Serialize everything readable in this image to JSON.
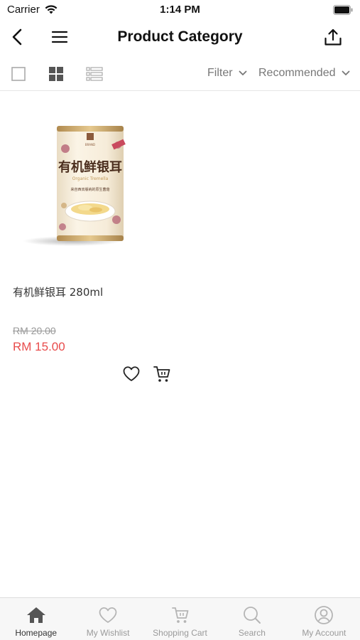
{
  "status_bar": {
    "carrier": "Carrier",
    "time": "1:14 PM"
  },
  "header": {
    "title": "Product Category"
  },
  "toolbar": {
    "filter_label": "Filter",
    "sort_label": "Recommended"
  },
  "product": {
    "name": "有机鲜银耳 280ml",
    "original_price": "RM 20.00",
    "sale_price": "RM 15.00",
    "image": {
      "title_text": "有机鲜银耳",
      "subtitle_text": "Organic Tremella",
      "tagline_text": "来自西双版纳的原生菌菇"
    }
  },
  "tab_bar": {
    "items": [
      {
        "label": "Homepage",
        "icon": "home-icon",
        "active": true
      },
      {
        "label": "My Wishlist",
        "icon": "heart-icon",
        "active": false
      },
      {
        "label": "Shopping Cart",
        "icon": "cart-icon",
        "active": false
      },
      {
        "label": "Search",
        "icon": "search-icon",
        "active": false
      },
      {
        "label": "My Account",
        "icon": "user-icon",
        "active": false
      }
    ]
  },
  "colors": {
    "accent_price": "#e84b4b",
    "active_tab": "#555555",
    "inactive_tab": "#b5b5b5"
  }
}
